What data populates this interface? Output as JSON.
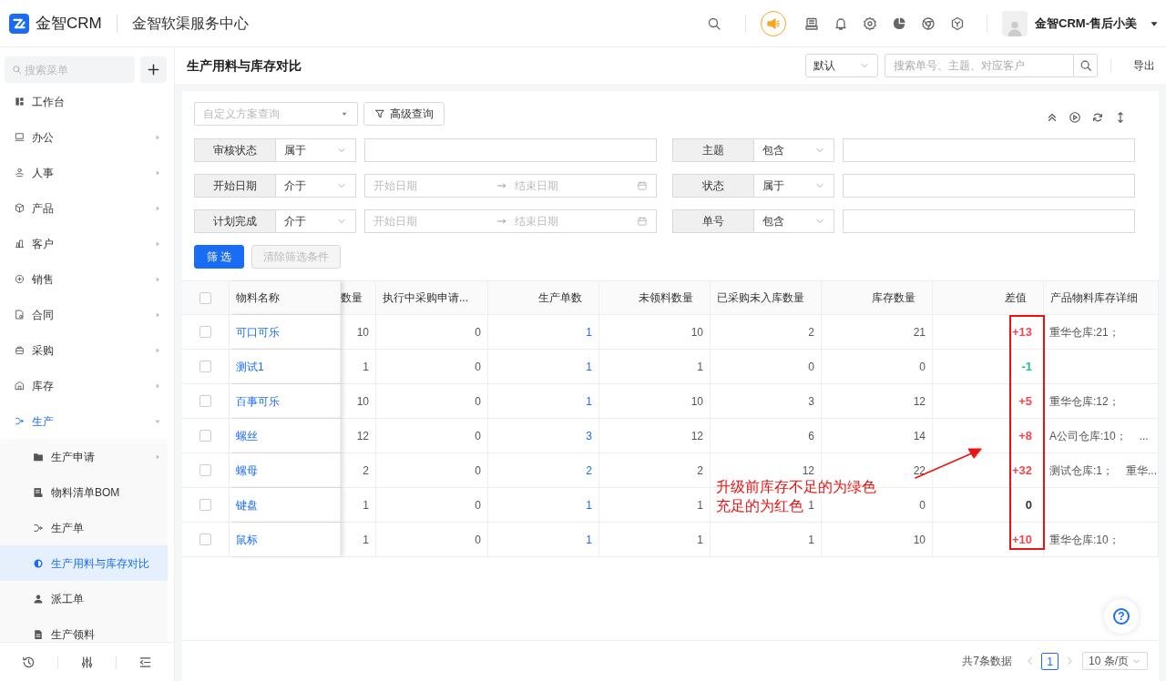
{
  "app": {
    "brand": "金智CRM",
    "title": "金智软渠服务中心"
  },
  "user": {
    "name": "金智CRM-售后小美"
  },
  "sidebar": {
    "search": {
      "placeholder": "搜索菜单"
    },
    "items": [
      {
        "label": "工作台",
        "selected": false
      },
      {
        "label": "办公",
        "selected": false,
        "expanded": false
      },
      {
        "label": "人事",
        "selected": false,
        "expanded": false
      },
      {
        "label": "产品",
        "selected": false,
        "expanded": false
      },
      {
        "label": "客户",
        "selected": false,
        "expanded": false
      },
      {
        "label": "销售",
        "selected": false,
        "expanded": false
      },
      {
        "label": "合同",
        "selected": false,
        "expanded": false
      },
      {
        "label": "采购",
        "selected": false,
        "expanded": false
      },
      {
        "label": "库存",
        "selected": false,
        "expanded": false
      },
      {
        "label": "生产",
        "selected": false,
        "expanded": true,
        "children": [
          {
            "label": "生产申请",
            "selected": false,
            "expanded": false
          },
          {
            "label": "物料清单BOM",
            "selected": false
          },
          {
            "label": "生产单",
            "selected": false
          },
          {
            "label": "生产用料与库存对比",
            "selected": true
          },
          {
            "label": "派工单",
            "selected": false
          },
          {
            "label": "生产领料",
            "selected": false
          }
        ]
      }
    ]
  },
  "page": {
    "title": "生产用料与库存对比",
    "view": "默认",
    "search": {
      "placeholder": "搜索单号、主题、对应客户"
    },
    "export": "导出"
  },
  "filters": {
    "scheme": {
      "placeholder": "自定义方案查询"
    },
    "advanced": "高级查询",
    "fields": [
      {
        "label": "审核状态",
        "operator": "属于",
        "kind": "text"
      },
      {
        "label": "主题",
        "operator": "包含",
        "kind": "text"
      },
      {
        "label": "开始日期",
        "operator": "介于",
        "kind": "date_range",
        "start_placeholder": "开始日期",
        "end_placeholder": "结束日期"
      },
      {
        "label": "状态",
        "operator": "属于",
        "kind": "text"
      },
      {
        "label": "计划完成",
        "operator": "介于",
        "kind": "date_range",
        "start_placeholder": "开始日期",
        "end_placeholder": "结束日期"
      },
      {
        "label": "单号",
        "operator": "包含",
        "kind": "text"
      }
    ],
    "buttons": [
      {
        "label": "筛 选",
        "disabled": false
      },
      {
        "label": "清除筛选条件",
        "disabled": true
      }
    ]
  },
  "table": {
    "all_checked": false,
    "columns": [
      "物料名称",
      "数量",
      "执行中采购申请...",
      "生产单数",
      "未领料数量",
      "已采购未入库数量",
      "库存数量",
      "差值",
      "产品物料库存详细"
    ],
    "rows": [
      {
        "checked": false,
        "cells": [
          "可口可乐",
          "10",
          "0",
          "1",
          "10",
          "2",
          "21"
        ],
        "diff": {
          "text": "+13",
          "color": "#f5454f"
        },
        "details": [
          "重华仓库:21；"
        ]
      },
      {
        "checked": false,
        "cells": [
          "测试1",
          "1",
          "0",
          "1",
          "1",
          "0",
          "0"
        ],
        "diff": {
          "text": "-1",
          "color": "#19be9b"
        }
      },
      {
        "checked": false,
        "cells": [
          "百事可乐",
          "10",
          "0",
          "1",
          "10",
          "3",
          "12"
        ],
        "diff": {
          "text": "+5",
          "color": "#f5454f"
        },
        "details": [
          "重华仓库:12；"
        ]
      },
      {
        "checked": false,
        "cells": [
          "螺丝",
          "12",
          "0",
          "3",
          "12",
          "6",
          "14"
        ],
        "diff": {
          "text": "+8",
          "color": "#f5454f"
        },
        "details": [
          "A公司仓库:10；",
          "..."
        ]
      },
      {
        "checked": false,
        "cells": [
          "螺母",
          "2",
          "0",
          "2",
          "2",
          "12",
          "22"
        ],
        "diff": {
          "text": "+32",
          "color": "#f5454f"
        },
        "details": [
          "测试仓库:1；",
          "重华..."
        ]
      },
      {
        "checked": false,
        "cells": [
          "键盘",
          "1",
          "0",
          "1",
          "1",
          "1",
          "0"
        ],
        "diff": {
          "text": "0",
          "color": "#333333"
        }
      },
      {
        "checked": false,
        "cells": [
          "鼠标",
          "1",
          "0",
          "1",
          "1",
          "1",
          "10"
        ],
        "diff": {
          "text": "+10",
          "color": "#f5454f"
        },
        "details": [
          "重华仓库:10；"
        ]
      }
    ]
  },
  "annotation": {
    "lines": [
      "升级前库存不足的为绿色",
      "充足的为红色"
    ]
  },
  "pagination": {
    "total": "共7条数据",
    "pages": [
      {
        "label": "1",
        "selected": true
      }
    ],
    "page_size": "10 条/页"
  },
  "help": {
    "label": "?"
  }
}
